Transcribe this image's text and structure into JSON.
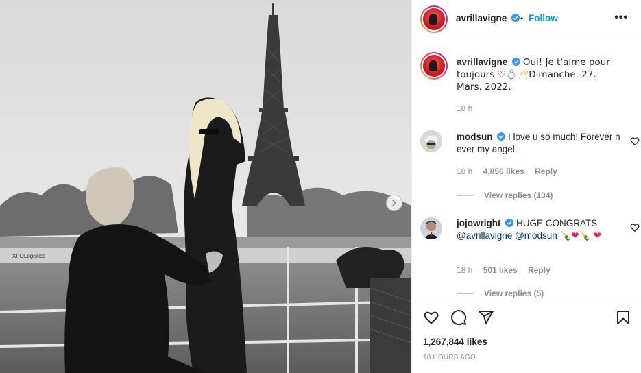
{
  "post": {
    "author": "avrillavigne",
    "follow_label": "Follow",
    "separator": "•",
    "more_label": "•••",
    "caption_text": "Oui! Je t'aime pour toujours ♡💍🥂Dimanche. 27. Mars. 2022.",
    "caption_time": "18 h"
  },
  "comments": [
    {
      "username": "modsun",
      "text": "I love u so much! Forever n ever my angel.",
      "time": "18 h",
      "likes": "4,856 likes",
      "reply_label": "Reply",
      "view_replies": "View replies (134)"
    },
    {
      "username": "jojowright",
      "text_a": "HUGE CONGRATS",
      "mention_1": "@avrillavigne",
      "mention_2": "@modsun",
      "text_emoji": "🍾❤🍾 ❤",
      "time": "18 h",
      "likes": "501 likes",
      "reply_label": "Reply",
      "view_replies": "View replies (5)"
    }
  ],
  "footer": {
    "likes": "1,267,844 likes",
    "timestamp": "18 HOURS AGO"
  },
  "icons": {
    "like": "heart-outline-icon",
    "comment": "comment-bubble-icon",
    "share": "paper-plane-icon",
    "save": "bookmark-icon",
    "next": "chevron-right-icon",
    "verified": "verified-badge-icon"
  },
  "colors": {
    "link": "#0095f6",
    "mention": "#00376b",
    "verified": "#3897f0",
    "muted": "#8e8e8e"
  }
}
